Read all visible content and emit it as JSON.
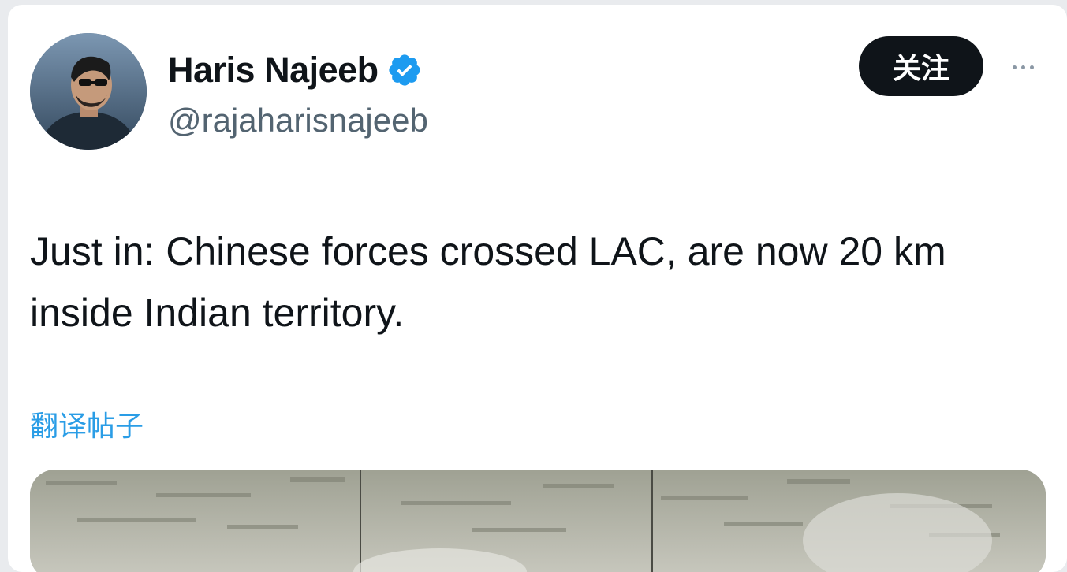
{
  "post": {
    "author": {
      "display_name": "Haris Najeeb",
      "handle": "@rajaharisnajeeb",
      "verified": true,
      "verified_color": "#1d9bf0"
    },
    "follow_label": "关注",
    "more_icon": "more-horizontal-icon",
    "text": "Just in: Chinese forces crossed LAC, are now 20 km inside Indian territory.",
    "translate_label": "翻译帖子",
    "media": {
      "type": "image"
    }
  },
  "colors": {
    "text_primary": "#0f1419",
    "text_secondary": "#536471",
    "link": "#2a9de6",
    "follow_button_bg": "#0f1419"
  }
}
